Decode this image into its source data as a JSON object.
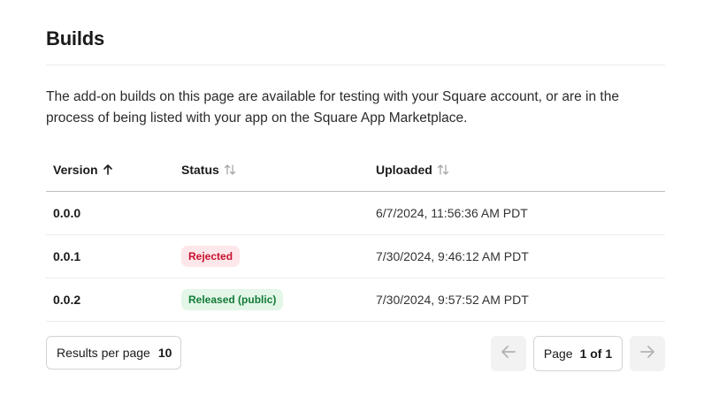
{
  "page": {
    "title": "Builds",
    "description": "The add-on builds on this page are available for testing with your Square account, or are in the process of being listed with your app on the Square App Marketplace."
  },
  "table": {
    "columns": [
      {
        "label": "Version",
        "sort": "ascending",
        "sort_icon": "arrow-up-icon"
      },
      {
        "label": "Status",
        "sort": "none",
        "sort_icon": "sort-updown-icon"
      },
      {
        "label": "Uploaded",
        "sort": "none",
        "sort_icon": "sort-updown-icon"
      }
    ],
    "rows": [
      {
        "version": "0.0.0",
        "status": "",
        "uploaded": "6/7/2024, 11:56:36 AM PDT"
      },
      {
        "version": "0.0.1",
        "status": "Rejected",
        "uploaded": "7/30/2024, 9:46:12 AM PDT"
      },
      {
        "version": "0.0.2",
        "status": "Released (public)",
        "uploaded": "7/30/2024, 9:57:52 AM PDT"
      }
    ]
  },
  "pagination": {
    "results_label": "Results per page",
    "results_value": "10",
    "page_word": "Page",
    "page_value": "1 of 1",
    "prev_icon": "arrow-left-icon",
    "next_icon": "arrow-right-icon"
  },
  "colors": {
    "rejected_bg": "#fde7ea",
    "rejected_text": "#c8102e",
    "released_bg": "#e3f6e8",
    "released_text": "#117a35"
  }
}
